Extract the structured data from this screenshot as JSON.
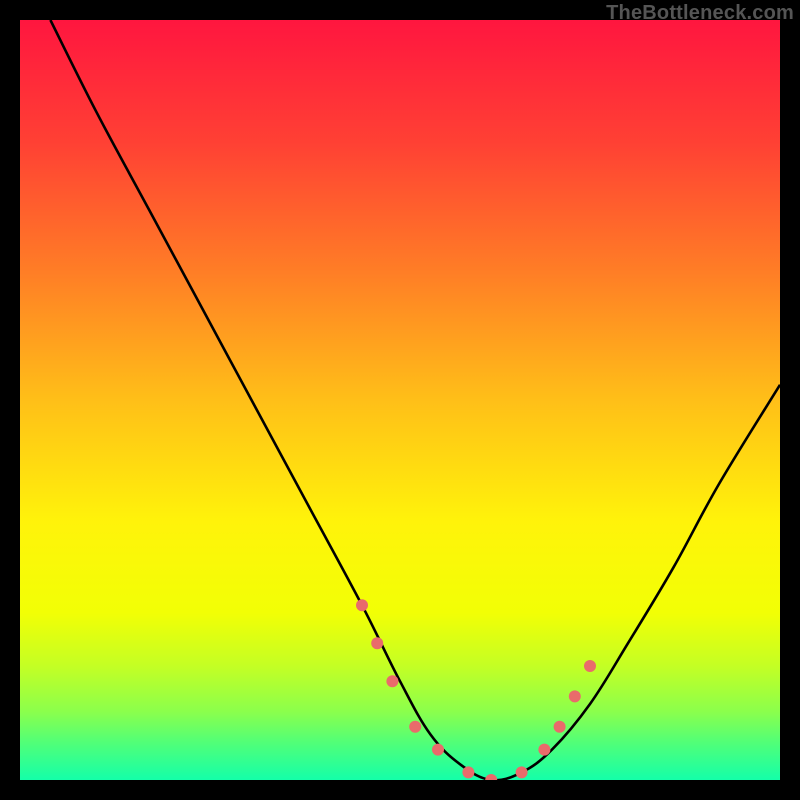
{
  "watermark": "TheBottleneck.com",
  "chart_data": {
    "type": "line",
    "title": "",
    "xlabel": "",
    "ylabel": "",
    "xlim": [
      0,
      100
    ],
    "ylim": [
      0,
      100
    ],
    "grid": false,
    "legend": null,
    "gradient_stops": [
      {
        "offset": 0.0,
        "color": "#ff163f"
      },
      {
        "offset": 0.16,
        "color": "#ff4034"
      },
      {
        "offset": 0.33,
        "color": "#ff7d26"
      },
      {
        "offset": 0.5,
        "color": "#ffbf18"
      },
      {
        "offset": 0.66,
        "color": "#fff30a"
      },
      {
        "offset": 0.78,
        "color": "#f2ff05"
      },
      {
        "offset": 0.85,
        "color": "#c4ff24"
      },
      {
        "offset": 0.91,
        "color": "#8bff4c"
      },
      {
        "offset": 0.95,
        "color": "#52ff77"
      },
      {
        "offset": 1.0,
        "color": "#14ffa9"
      }
    ],
    "series": [
      {
        "name": "bottleneck-curve",
        "x": [
          4,
          10,
          17,
          24,
          31,
          38,
          45,
          50,
          54,
          58,
          62,
          66,
          70,
          75,
          80,
          86,
          92,
          100
        ],
        "y": [
          100,
          88,
          75,
          62,
          49,
          36,
          23,
          13,
          6,
          2,
          0,
          1,
          4,
          10,
          18,
          28,
          39,
          52
        ]
      }
    ],
    "scatter": {
      "name": "highlight-points",
      "x": [
        45,
        47,
        49,
        52,
        55,
        59,
        62,
        66,
        69,
        71,
        73,
        75
      ],
      "y": [
        23,
        18,
        13,
        7,
        4,
        1,
        0,
        1,
        4,
        7,
        11,
        15
      ],
      "color": "#e96b6b",
      "radius": 6
    }
  }
}
